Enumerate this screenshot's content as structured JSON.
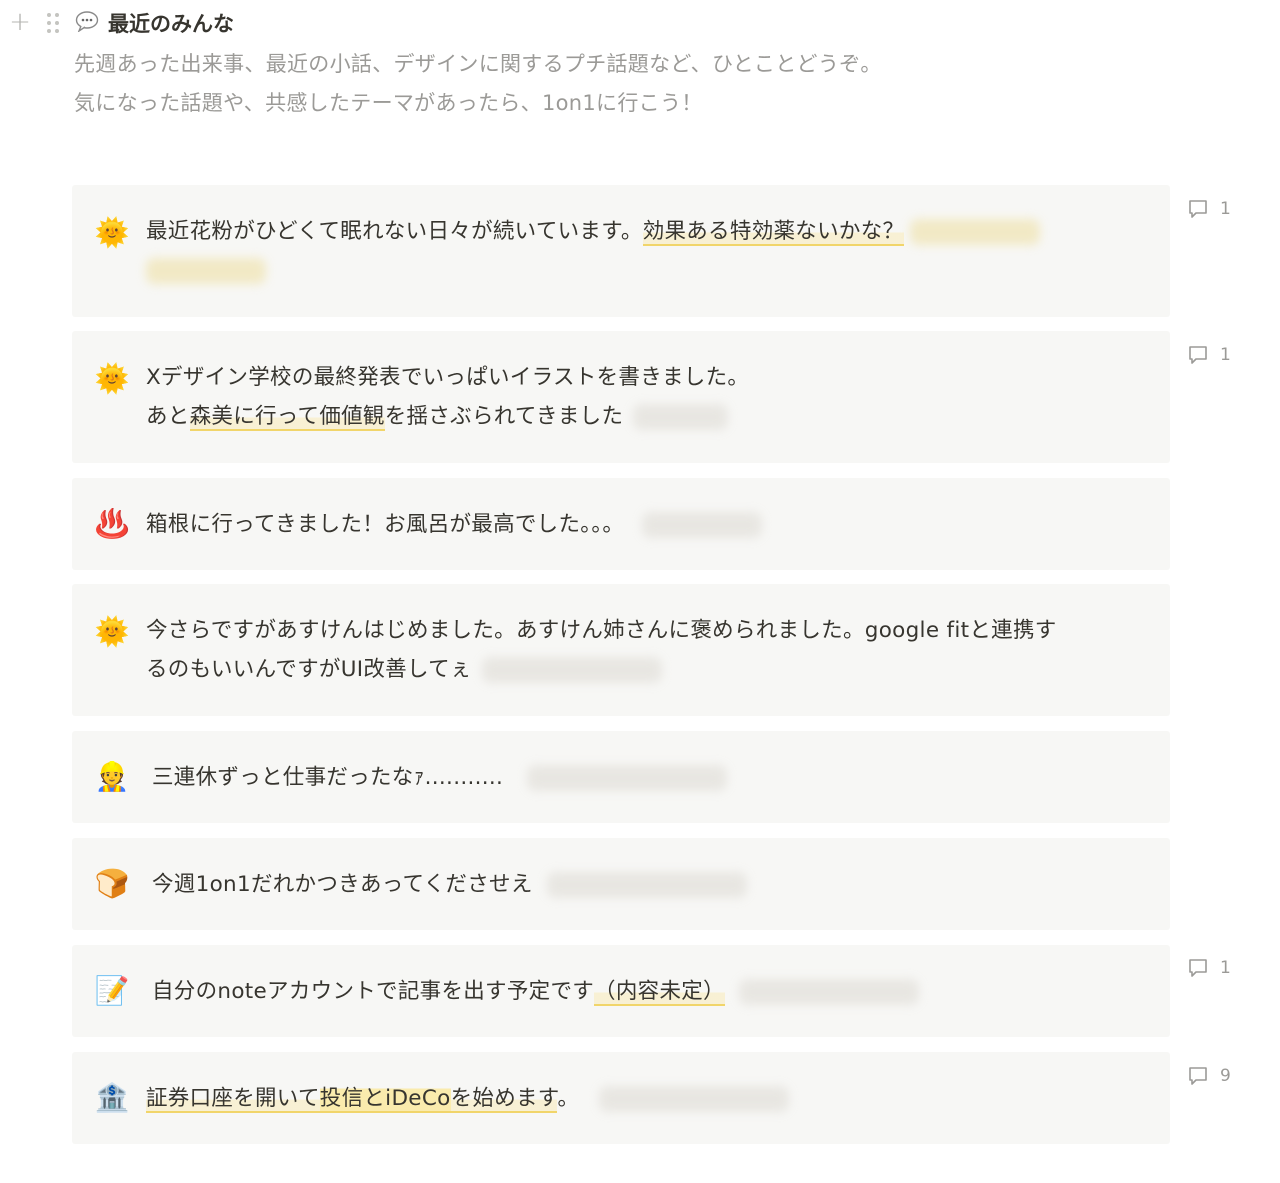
{
  "header": {
    "bubble_icon": "speech-bubble-icon",
    "title": "最近のみんな",
    "description_line1": "先週あった出来事、最近の小話、デザインに関するプチ話題など、ひとことどうぞ。",
    "description_line2": "気になった話題や、共感したテーマがあったら、1on1に行こう！"
  },
  "posts": [
    {
      "emoji": "🌞",
      "emoji_name": "sun-with-face-icon",
      "text_a": "最近花粉がひどくて眠れない日々が続いています。",
      "highlight": "効果ある特効薬ないかな？",
      "comments": "1"
    },
    {
      "emoji": "🌞",
      "emoji_name": "sun-with-face-icon",
      "line1": "Xデザイン学校の最終発表でいっぱいイラストを書きました。",
      "line2_a": "あと",
      "highlight": "森美に行って価値観",
      "line2_b": "を揺さぶられてきました",
      "comments": "1"
    },
    {
      "emoji": "♨️",
      "emoji_name": "hot-springs-icon",
      "text": "箱根に行ってきました！お風呂が最高でした。。。"
    },
    {
      "emoji": "🌞",
      "emoji_name": "sun-with-face-icon",
      "line1": "今さらですがあすけんはじめました。あすけん姉さんに褒められました。google fitと連携す",
      "line2": "るのもいいんですがUI改善してぇ"
    },
    {
      "emoji": "👷",
      "emoji_name": "construction-worker-icon",
      "text": "三連休ずっと仕事だったなｧ..........."
    },
    {
      "emoji": "🍞",
      "emoji_name": "bread-icon",
      "text": "今週1on1だれかつきあってくださせえ"
    },
    {
      "emoji": "📝",
      "emoji_name": "memo-icon",
      "text_a": "自分のnoteアカウントで記事を出す予定です",
      "highlight": "（内容未定）",
      "comments": "1"
    },
    {
      "emoji": "🏦",
      "emoji_name": "bank-icon",
      "hl_a": "証券口座を開いて",
      "hl_b": "投信とiDeCo",
      "hl_c": "を始めます",
      "text_end": "。",
      "comments": "9"
    }
  ]
}
